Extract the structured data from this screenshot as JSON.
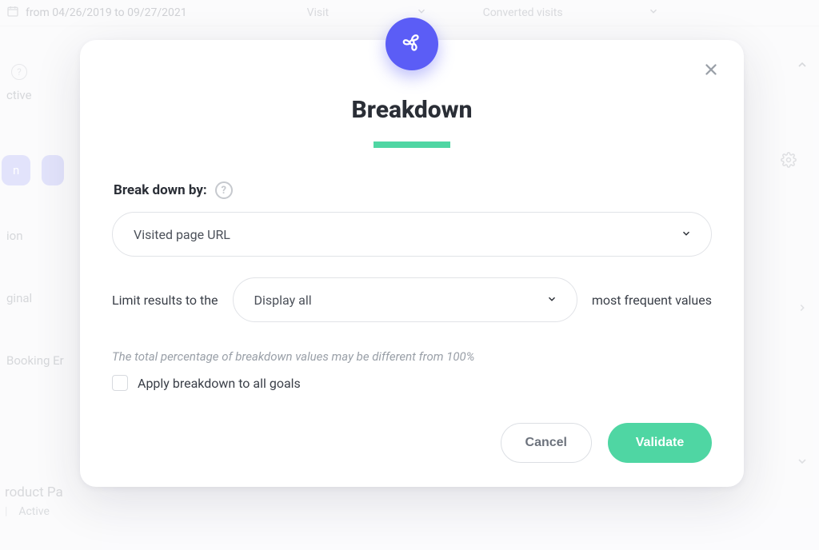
{
  "header": {
    "date_range": "from 04/26/2019 to 09/27/2021",
    "select1": "Visit",
    "select2": "Converted visits"
  },
  "side": {
    "status_label": "ctive",
    "button1_label": "n",
    "item1": "ion",
    "item2": "ginal",
    "item3": "Booking Er"
  },
  "footer": {
    "title": "roduct Pa",
    "status_sep": "|",
    "status_text": "Active"
  },
  "modal": {
    "title": "Breakdown",
    "break_by_label": "Break down by:",
    "break_by_value": "Visited page URL",
    "limit_prefix": "Limit results to the",
    "limit_value": "Display all",
    "limit_suffix": "most frequent values",
    "hint": "The total percentage of breakdown values may be different from 100%",
    "apply_all_label": "Apply breakdown to all goals",
    "cancel_label": "Cancel",
    "validate_label": "Validate"
  }
}
